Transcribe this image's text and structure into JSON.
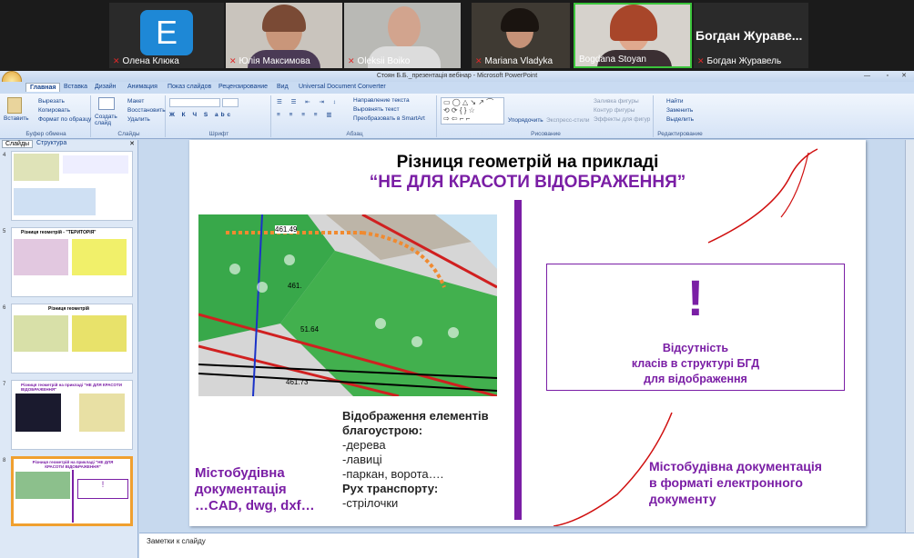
{
  "zoom": {
    "participants": [
      {
        "name": "Олена Клюка",
        "avatar_letter": "E",
        "muted": true
      },
      {
        "name": "Юлія Максимова",
        "muted": true
      },
      {
        "name": "Oleksii Boiko",
        "muted": true
      },
      {
        "name": "Mariana Vladyka",
        "muted": true
      },
      {
        "name": "Bogdana Stoyan",
        "muted": false,
        "active_speaker": true
      },
      {
        "name": "Богдан Журавель",
        "muted": true,
        "large_name": "Богдан Жураве..."
      }
    ]
  },
  "window": {
    "title": "Стоян Б.Б._презентація вебінар - Microsoft PowerPoint"
  },
  "ribbon": {
    "tabs": [
      "Главная",
      "Вставка",
      "Дизайн",
      "Анимация",
      "Показ слайдов",
      "Рецензирование",
      "Вид",
      "Universal Document Converter"
    ],
    "active_tab": "Главная",
    "clipboard": {
      "paste": "Вставить",
      "cut": "Вырезать",
      "copy": "Копировать",
      "format": "Формат по образцу",
      "label": "Буфер обмена"
    },
    "slides": {
      "new": "Создать слайд",
      "layout": "Макет",
      "reset": "Восстановить",
      "delete": "Удалить",
      "label": "Слайды"
    },
    "font": {
      "label": "Шрифт"
    },
    "paragraph": {
      "dir": "Направление текста",
      "align": "Выровнять текст",
      "smartart": "Преобразовать в SmartArt",
      "label": "Абзац"
    },
    "drawing": {
      "arrange": "Упорядочить",
      "styles": "Экспресс-стили",
      "fill": "Заливка фигуры",
      "outline": "Контур фигуры",
      "effects": "Эффекты для фигур",
      "label": "Рисование"
    },
    "editing": {
      "find": "Найти",
      "replace": "Заменить",
      "select": "Выделить",
      "label": "Редактирование"
    }
  },
  "left_pane": {
    "tab_slides": "Слайды",
    "tab_outline": "Структура",
    "slide_numbers": [
      "4",
      "5",
      "6",
      "7",
      "8"
    ],
    "selected": "8",
    "thumb_titles": [
      "",
      "Різниця геометрій - \"ТЕРИТОРІЯ\"",
      "Різниця геометрій",
      "Різниця геометрій на прикладі \"НЕ ДЛЯ КРАСОТИ ВІДОБРАЖЕННЯ\"",
      "Різниця геометрій на прикладі \"НЕ ДЛЯ КРАСОТИ ВІДОБРАЖЕННЯ\""
    ]
  },
  "slide": {
    "title_line1": "Різниця  геометрій  на прикладі",
    "title_line2": "“НЕ ДЛЯ КРАСОТИ ВІДОБРАЖЕННЯ”",
    "map_labels": [
      "461.49",
      "461.",
      "51.64",
      "461.73"
    ],
    "elements_heading": "Відображення елементів благоустрою:",
    "elements": [
      "-дерева",
      "-лавиці",
      "-паркан, ворота….",
      "Рух транспорту:",
      "-стрілочки"
    ],
    "left_caption": [
      "Містобудівна",
      "документація",
      "…CAD, dwg, dxf…"
    ],
    "exclamation": "!",
    "box_text": [
      "Відсутність",
      "класів в структурі БГД",
      "для відображення"
    ],
    "right_caption": [
      "Містобудівна документація",
      "в  форматі електронного",
      "документу"
    ],
    "accent_color": "#7a1ea5"
  },
  "notes": {
    "placeholder": "Заметки к слайду"
  }
}
